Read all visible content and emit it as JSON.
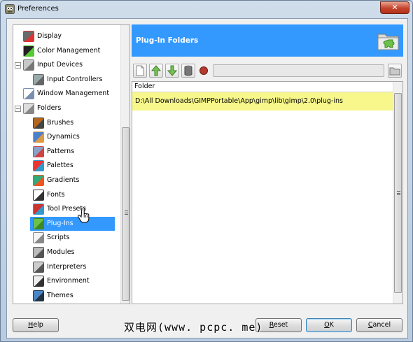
{
  "window": {
    "title": "Preferences",
    "close_glyph": "✕"
  },
  "tree": {
    "items": [
      {
        "label": "Display",
        "icon": "display-icon",
        "level": 1,
        "expander": ""
      },
      {
        "label": "Color Management",
        "icon": "color-management-icon",
        "level": 1,
        "expander": ""
      },
      {
        "label": "Input Devices",
        "icon": "input-devices-icon",
        "level": 1,
        "expander": "−"
      },
      {
        "label": "Input Controllers",
        "icon": "input-controllers-icon",
        "level": 2,
        "expander": ""
      },
      {
        "label": "Window Management",
        "icon": "window-management-icon",
        "level": 1,
        "expander": ""
      },
      {
        "label": "Folders",
        "icon": "folders-icon",
        "level": 1,
        "expander": "−"
      },
      {
        "label": "Brushes",
        "icon": "brushes-icon",
        "level": 2,
        "expander": ""
      },
      {
        "label": "Dynamics",
        "icon": "dynamics-icon",
        "level": 2,
        "expander": ""
      },
      {
        "label": "Patterns",
        "icon": "patterns-icon",
        "level": 2,
        "expander": ""
      },
      {
        "label": "Palettes",
        "icon": "palettes-icon",
        "level": 2,
        "expander": ""
      },
      {
        "label": "Gradients",
        "icon": "gradients-icon",
        "level": 2,
        "expander": ""
      },
      {
        "label": "Fonts",
        "icon": "fonts-icon",
        "level": 2,
        "expander": ""
      },
      {
        "label": "Tool Presets",
        "icon": "tool-presets-icon",
        "level": 2,
        "expander": ""
      },
      {
        "label": "Plug-Ins",
        "icon": "plug-ins-icon",
        "level": 2,
        "expander": "",
        "selected": true
      },
      {
        "label": "Scripts",
        "icon": "scripts-icon",
        "level": 2,
        "expander": ""
      },
      {
        "label": "Modules",
        "icon": "modules-icon",
        "level": 2,
        "expander": ""
      },
      {
        "label": "Interpreters",
        "icon": "interpreters-icon",
        "level": 2,
        "expander": ""
      },
      {
        "label": "Environment",
        "icon": "environment-icon",
        "level": 2,
        "expander": ""
      },
      {
        "label": "Themes",
        "icon": "themes-icon",
        "level": 2,
        "expander": ""
      }
    ]
  },
  "header": {
    "title": "Plug-In Folders",
    "icon": "plug-in-folder-icon",
    "background": "#3399ff"
  },
  "toolbar": {
    "buttons": [
      "new-folder-icon",
      "move-up-icon",
      "move-down-icon",
      "delete-icon",
      "record-icon"
    ],
    "path_value": "",
    "browse_icon": "browse-folder-icon"
  },
  "folder_list": {
    "column_header": "Folder",
    "rows": [
      "D:\\All Downloads\\GIMPPortable\\App\\gimp\\lib\\gimp\\2.0\\plug-ins"
    ],
    "highlight_color": "#f7f78c"
  },
  "buttons": {
    "help": {
      "mnemonic": "H",
      "rest": "elp"
    },
    "reset": {
      "mnemonic": "R",
      "rest": "eset"
    },
    "ok": {
      "mnemonic": "O",
      "rest": "K"
    },
    "cancel": {
      "mnemonic": "C",
      "rest": "ancel"
    }
  },
  "watermark": "双电网(www. pcpc. me)"
}
